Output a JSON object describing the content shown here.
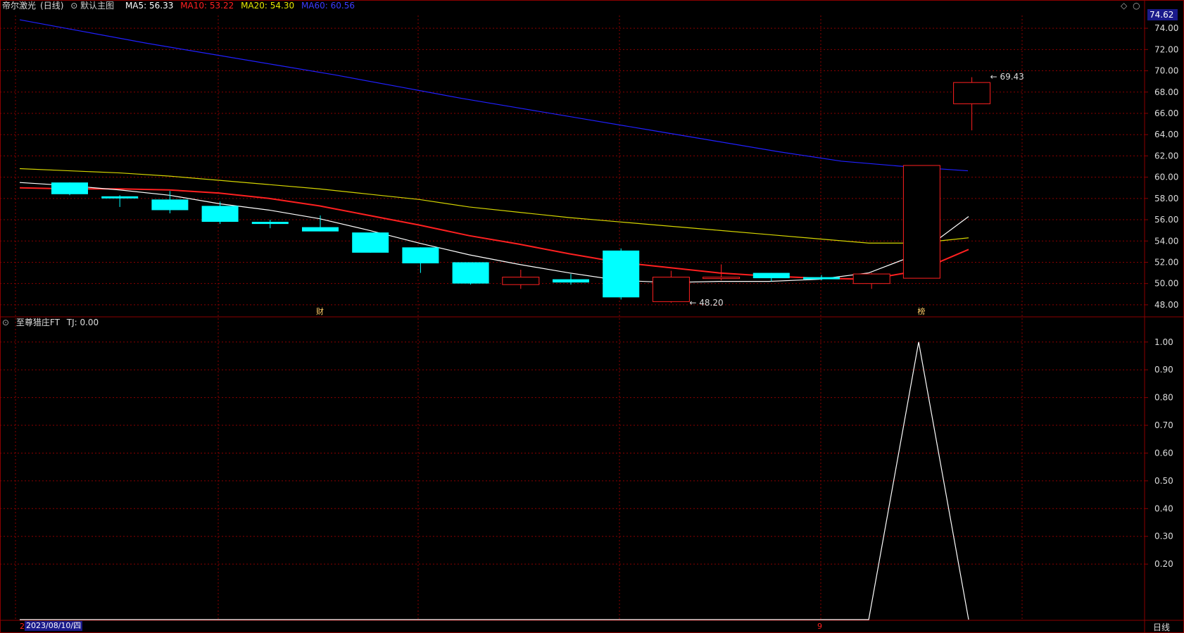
{
  "header": {
    "stock_name": "帝尔激光",
    "period": "(日线)",
    "main_chart_label": "默认主图",
    "ma5": "MA5: 56.33",
    "ma10": "MA10: 53.22",
    "ma20": "MA20: 54.30",
    "ma60": "MA60: 60.56",
    "last_price_tag": "74.62"
  },
  "indicator": {
    "name": "至尊猎庄FT",
    "value_label": "TJ: 0.00"
  },
  "footer": {
    "date_label": "2023/08/10/四",
    "period_button": "日线",
    "left_marker": "2",
    "mid_marker": "9"
  },
  "colors": {
    "background": "#000000",
    "grid": "#8b0000",
    "up": "#ff2020",
    "down": "#00ffff",
    "ma5": "#ffffff",
    "ma10": "#ff2020",
    "ma20": "#d4d400",
    "ma60": "#2020ff"
  },
  "chart_data": [
    {
      "type": "candlestick",
      "y_ticks": [
        48,
        50,
        52,
        54,
        56,
        58,
        60,
        62,
        64,
        66,
        68,
        70,
        72,
        74
      ],
      "ylim": [
        47,
        75.2
      ],
      "candles": [
        {
          "o": 59.5,
          "h": 59.5,
          "l": 58.3,
          "c": 58.4
        },
        {
          "o": 58.2,
          "h": 58.3,
          "l": 57.2,
          "c": 58.0
        },
        {
          "o": 57.9,
          "h": 58.7,
          "l": 56.6,
          "c": 56.9
        },
        {
          "o": 57.3,
          "h": 57.7,
          "l": 55.6,
          "c": 55.8
        },
        {
          "o": 55.8,
          "h": 56.0,
          "l": 55.2,
          "c": 55.6
        },
        {
          "o": 55.3,
          "h": 56.4,
          "l": 54.9,
          "c": 54.9
        },
        {
          "o": 54.8,
          "h": 54.8,
          "l": 52.9,
          "c": 52.9
        },
        {
          "o": 53.4,
          "h": 53.4,
          "l": 51.0,
          "c": 51.9
        },
        {
          "o": 52.0,
          "h": 52.0,
          "l": 49.9,
          "c": 50.0
        },
        {
          "o": 49.9,
          "h": 51.3,
          "l": 49.5,
          "c": 50.6
        },
        {
          "o": 50.4,
          "h": 50.9,
          "l": 49.9,
          "c": 50.1
        },
        {
          "o": 53.1,
          "h": 53.3,
          "l": 48.5,
          "c": 48.7
        },
        {
          "o": 48.3,
          "h": 51.2,
          "l": 48.2,
          "c": 50.6
        },
        {
          "o": 50.5,
          "h": 51.8,
          "l": 50.3,
          "c": 50.6
        },
        {
          "o": 51.0,
          "h": 51.0,
          "l": 50.2,
          "c": 50.5
        },
        {
          "o": 50.6,
          "h": 50.8,
          "l": 50.3,
          "c": 50.4
        },
        {
          "o": 50.0,
          "h": 51.0,
          "l": 49.5,
          "c": 50.9
        },
        {
          "o": 50.5,
          "h": 61.1,
          "l": 50.5,
          "c": 61.1
        },
        {
          "o": 66.9,
          "h": 69.4,
          "l": 64.4,
          "c": 68.9
        }
      ],
      "ma5": [
        59.5,
        59.2,
        58.8,
        58.3,
        57.5,
        56.9,
        56.1,
        55.0,
        53.8,
        52.7,
        51.8,
        51.0,
        50.3,
        50.1,
        50.2,
        50.2,
        50.4,
        51.0,
        52.8,
        56.3
      ],
      "ma10": [
        59.0,
        58.9,
        58.9,
        58.8,
        58.5,
        58.0,
        57.3,
        56.4,
        55.5,
        54.5,
        53.7,
        52.8,
        52.0,
        51.5,
        51.0,
        50.7,
        50.5,
        50.4,
        51.2,
        53.2
      ],
      "ma20": [
        60.8,
        60.6,
        60.4,
        60.1,
        59.7,
        59.3,
        58.9,
        58.4,
        57.9,
        57.2,
        56.7,
        56.2,
        55.8,
        55.4,
        55.0,
        54.6,
        54.2,
        53.8,
        53.8,
        54.3
      ],
      "ma60": [
        74.8,
        73.7,
        72.6,
        71.6,
        70.6,
        69.6,
        68.5,
        67.4,
        66.4,
        65.4,
        64.4,
        63.4,
        62.4,
        61.5,
        61.0,
        60.6
      ],
      "annotations": [
        {
          "text": "69.43",
          "candle": 18,
          "value": 69.43
        },
        {
          "text": "48.20",
          "candle": 12,
          "value": 48.2
        }
      ],
      "event_markers": [
        {
          "text": "财",
          "candle": 5
        },
        {
          "text": "榜",
          "candle": 17
        }
      ]
    },
    {
      "type": "line",
      "name": "TJ",
      "y_ticks": [
        0.2,
        0.3,
        0.4,
        0.5,
        0.6,
        0.7,
        0.8,
        0.9,
        1.0
      ],
      "ylim": [
        0,
        1.04
      ],
      "values": [
        0,
        0,
        0,
        0,
        0,
        0,
        0,
        0,
        0,
        0,
        0,
        0,
        0,
        0,
        0,
        0,
        0,
        0,
        1,
        0
      ]
    }
  ]
}
